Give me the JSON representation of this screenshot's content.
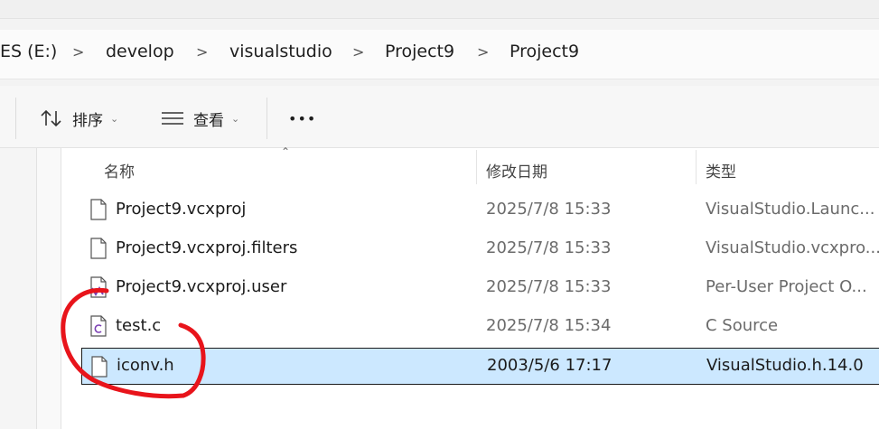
{
  "breadcrumb": {
    "items": [
      "ES (E:)",
      "develop",
      "visualstudio",
      "Project9",
      "Project9"
    ],
    "separator": ">"
  },
  "toolbar": {
    "sort_label": "排序",
    "view_label": "查看",
    "more_label": "•••"
  },
  "columns": {
    "name": "名称",
    "modified": "修改日期",
    "type": "类型"
  },
  "files": [
    {
      "name": "Project9.vcxproj",
      "modified": "2025/7/8 15:33",
      "type": "VisualStudio.Launc...",
      "icon": "file-icon"
    },
    {
      "name": "Project9.vcxproj.filters",
      "modified": "2025/7/8 15:33",
      "type": "VisualStudio.vcxpro...",
      "icon": "file-icon"
    },
    {
      "name": "Project9.vcxproj.user",
      "modified": "2025/7/8 15:33",
      "type": "Per-User Project O...",
      "icon": "vs-user-file-icon"
    },
    {
      "name": "test.c",
      "modified": "2025/7/8 15:34",
      "type": "C Source",
      "icon": "c-source-file-icon"
    },
    {
      "name": "iconv.h",
      "modified": "2003/5/6 17:17",
      "type": "VisualStudio.h.14.0",
      "icon": "file-icon",
      "selected": true
    }
  ],
  "colors": {
    "selection": "#cce8ff",
    "annotation": "#e8141b"
  }
}
